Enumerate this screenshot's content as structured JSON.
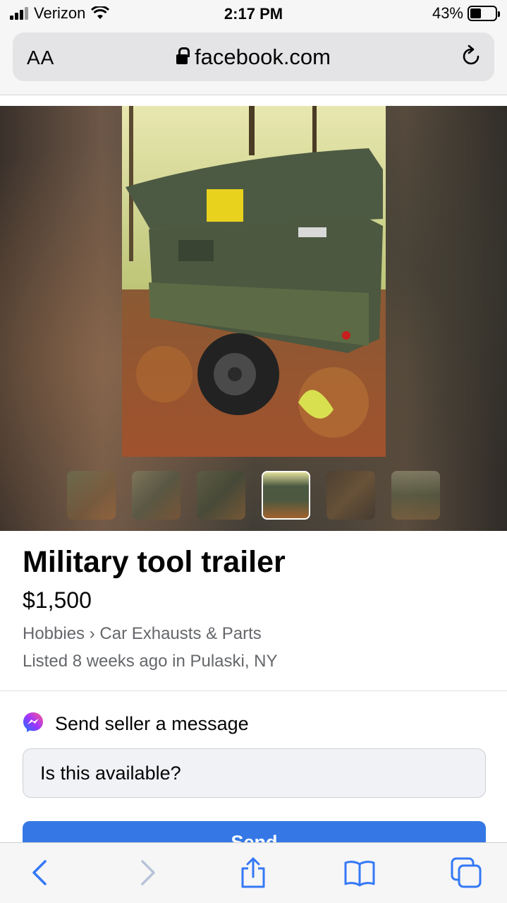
{
  "status_bar": {
    "carrier": "Verizon",
    "time": "2:17 PM",
    "battery_percent": "43%",
    "battery_level": 0.43
  },
  "browser": {
    "text_size_label": "AA",
    "url": "facebook.com"
  },
  "gallery": {
    "selected_index": 3,
    "thumbnail_count": 6
  },
  "listing": {
    "title": "Military tool trailer",
    "price": "$1,500",
    "category": "Hobbies › Car Exhausts & Parts",
    "listed": "Listed 8 weeks ago in Pulaski, NY"
  },
  "message": {
    "heading": "Send seller a message",
    "input_value": "Is this available?",
    "send_label": "Send"
  },
  "colors": {
    "send_button": "#3578e5",
    "secondary_text": "#65676b"
  }
}
